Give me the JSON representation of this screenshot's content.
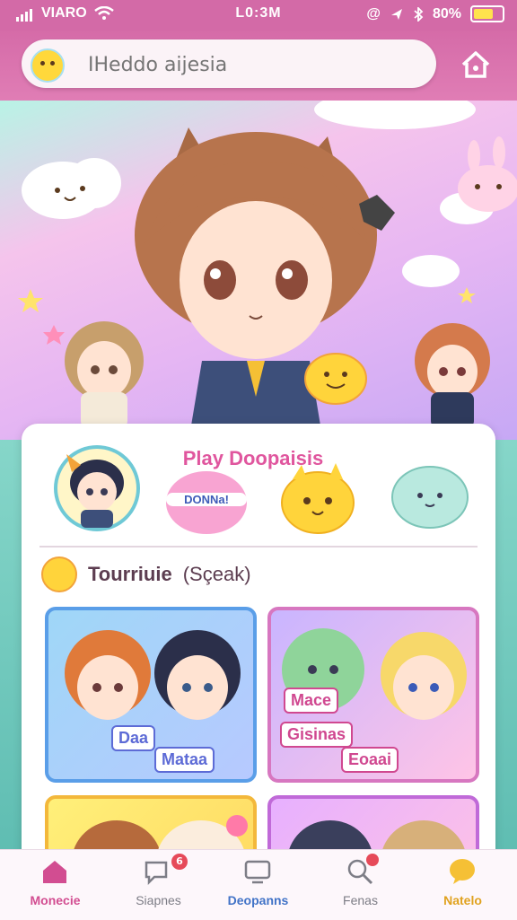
{
  "status_bar": {
    "carrier": "VIARO",
    "time": "L0:3M",
    "battery": "80%",
    "battery_level": 0.8
  },
  "search": {
    "placeholder": "IНеddo aijesia"
  },
  "card": {
    "title": "Play Doopaisis",
    "bubble_text": "DONNa!"
  },
  "section": {
    "title": "Tourriuie",
    "subtitle": "(Sçeak)"
  },
  "thumbnails": [
    {
      "label_top": "Daa",
      "label_bottom": "Mataa"
    },
    {
      "label_top": "Mace",
      "label_mid": "Gisinas",
      "label_bottom": "Eoaai"
    }
  ],
  "nav": [
    {
      "label": "Monecie",
      "icon": "home-icon",
      "color": "#d24d91"
    },
    {
      "label": "Siapnes",
      "icon": "chat-icon",
      "color": "#7d7d86",
      "badge": "6"
    },
    {
      "label": "Deopanns",
      "icon": "tv-icon",
      "color": "#4173c7"
    },
    {
      "label": "Fenas",
      "icon": "search-icon",
      "color": "#7d7d86"
    },
    {
      "label": "Natelo",
      "icon": "bubble-icon",
      "color": "#e0a21f"
    }
  ]
}
